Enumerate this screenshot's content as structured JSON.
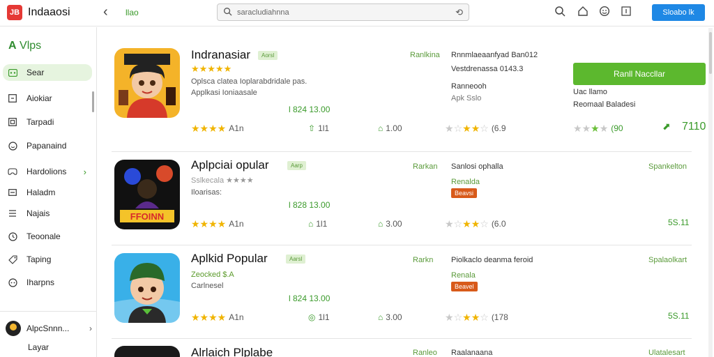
{
  "topbar": {
    "logo": "JB",
    "title": "Indaaosi",
    "crumb": "llao",
    "search_value": "saracludiahnna",
    "signin_label": "Sloabo lk"
  },
  "sidebar": {
    "header": "Vlps",
    "items": [
      {
        "label": "Sear",
        "icon": "grid-icon",
        "active": true
      },
      {
        "label": "Aiokiar",
        "icon": "square-icon"
      },
      {
        "label": "Tarpadi",
        "icon": "box-icon"
      },
      {
        "label": "Papanaind",
        "icon": "circle-icon"
      },
      {
        "label": "Hardolions",
        "icon": "gamepad-icon",
        "chevron": true
      },
      {
        "label": "Haladm",
        "icon": "minus-box-icon"
      },
      {
        "label": "Najais",
        "icon": "list-icon"
      },
      {
        "label": "Teoonale",
        "icon": "clock-icon"
      },
      {
        "label": "Taping",
        "icon": "tag-icon"
      },
      {
        "label": "Iharpns",
        "icon": "dots-circle-icon"
      }
    ],
    "user": "AlpcSnnn...",
    "footer": "Layar"
  },
  "cards": [
    {
      "title": "Indranasiar",
      "tag": "Aorsl",
      "stars_top": "★★★★★",
      "desc1": "Oplsca clatea Ioplarabdridale pas.",
      "desc2": "Applkasi Ioniaasale",
      "price": "l 824 13.00",
      "bot_stars": "★★★★",
      "bot_rating": "A1n",
      "bot_stat1": "1l1",
      "bot_stat2": "1.00",
      "mid_label": "Ranlkina",
      "mid_text1": "Rnnmlaeaanfyad Ban012",
      "mid_text2": "Vestdrenassa  0143.3",
      "mid_text3": "Ranneooh",
      "mid_text4": "Apk Sslo",
      "mid_rating": "(6.9",
      "install_label": "Ranll Naccllar",
      "right_text1": "Uac llamo",
      "right_text2": "Reomaal Baladesi",
      "right_rating": "(90",
      "right_big": "7110"
    },
    {
      "title": "Aplpciai opular",
      "tag": "Aarp",
      "desc1": "Sslkecala ★★★★",
      "desc2": "Iloarisas:",
      "price": "l 828 13.00",
      "bot_stars": "★★★★",
      "bot_rating": "A1n",
      "bot_stat1": "1l1",
      "bot_stat2": "3.00",
      "mid_label": "Rarkan",
      "mid_text1": "Sanlosi ophalla",
      "mid_green": "Renalda",
      "mid_badge": "Beavsi",
      "mid_rating": "(6.0",
      "right_label": "Spankelton",
      "right_val": "5S.11"
    },
    {
      "title": "Aplkid Popular",
      "tag": "Aarsl",
      "desc1": "Zeocked $.A",
      "desc2": "Carlnesel",
      "price": "l 824 13.00",
      "bot_stars": "★★★★",
      "bot_rating": "A1n",
      "bot_stat1": "1l1",
      "bot_stat2": "3.00",
      "mid_label": "Rarkn",
      "mid_text1": "Piolkaclo deanma feroid",
      "mid_green": "Renala",
      "mid_badge": "Beavel",
      "mid_rating": "(178",
      "right_label": "Spalaolkart",
      "right_val": "5S.11"
    },
    {
      "title": "Alrlaich Plplabe",
      "mid_label": "Ranleo",
      "mid_text1": "Raalanaana",
      "right_label": "Ulatalesart"
    }
  ]
}
